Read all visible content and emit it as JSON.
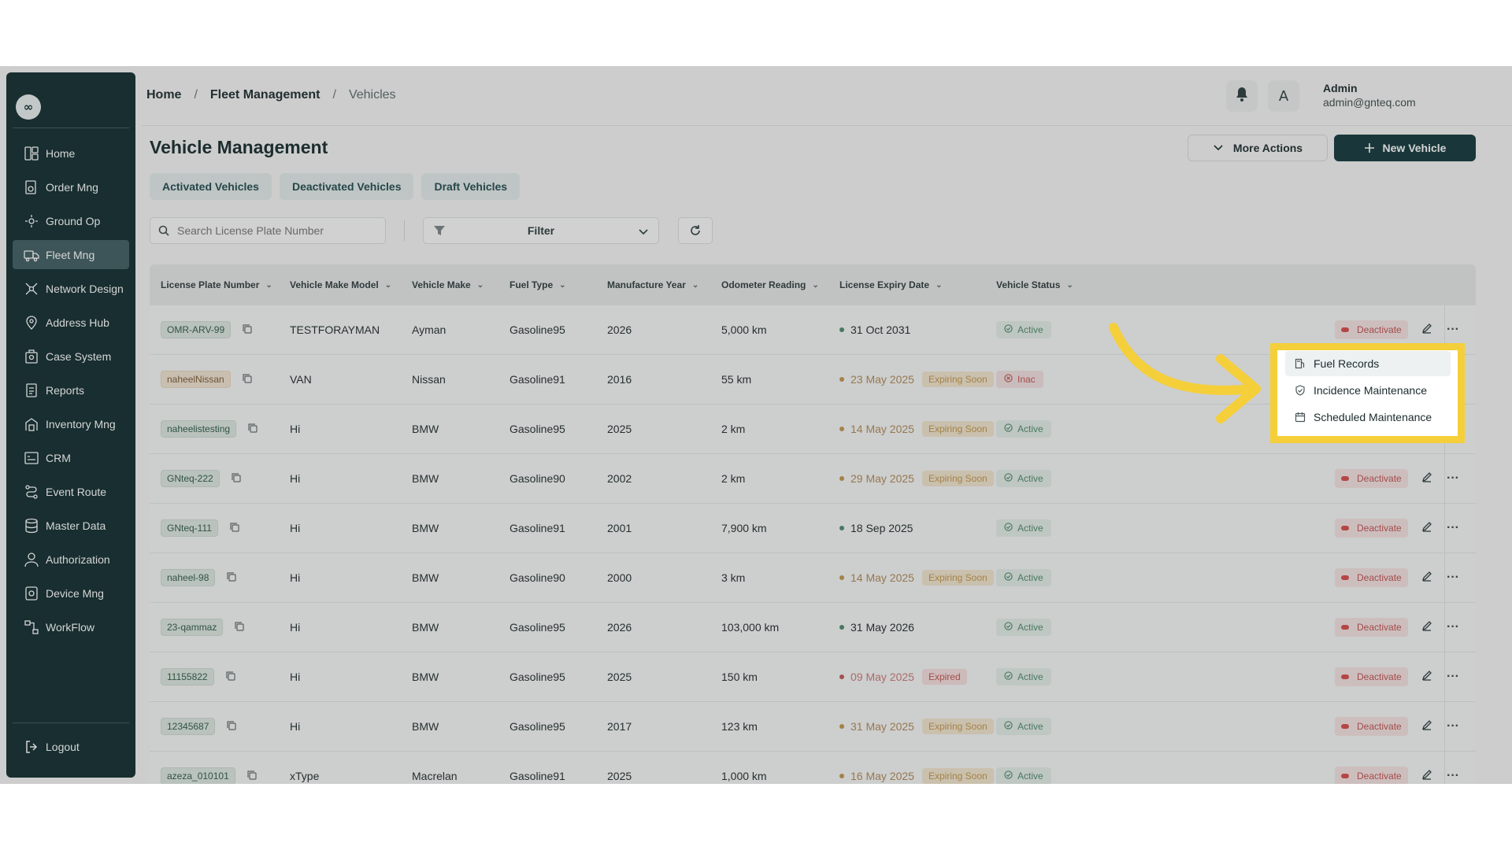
{
  "sidebar": {
    "logo": "∞",
    "items": [
      {
        "label": "Home",
        "icon": "dashboard-icon"
      },
      {
        "label": "Order Mng",
        "icon": "order-icon"
      },
      {
        "label": "Ground Op",
        "icon": "ground-icon"
      },
      {
        "label": "Fleet Mng",
        "icon": "truck-icon"
      },
      {
        "label": "Network Design",
        "icon": "network-icon"
      },
      {
        "label": "Address Hub",
        "icon": "location-icon"
      },
      {
        "label": "Case System",
        "icon": "case-icon"
      },
      {
        "label": "Reports",
        "icon": "report-icon"
      },
      {
        "label": "Inventory Mng",
        "icon": "inventory-icon"
      },
      {
        "label": "CRM",
        "icon": "crm-icon"
      },
      {
        "label": "Event Route",
        "icon": "route-icon"
      },
      {
        "label": "Master Data",
        "icon": "database-icon"
      },
      {
        "label": "Authorization",
        "icon": "user-icon"
      },
      {
        "label": "Device Mng",
        "icon": "device-icon"
      },
      {
        "label": "WorkFlow",
        "icon": "workflow-icon"
      }
    ],
    "active_index": 3,
    "logout_label": "Logout"
  },
  "header": {
    "breadcrumbs": [
      "Home",
      "Fleet Management",
      "Vehicles"
    ],
    "separator": "/",
    "translate_glyph": "A",
    "user_name": "Admin",
    "user_email": "admin@gnteq.com"
  },
  "page": {
    "title": "Vehicle Management",
    "more_actions_label": "More Actions",
    "new_vehicle_label": "New Vehicle",
    "tabs": [
      "Activated Vehicles",
      "Deactivated Vehicles",
      "Draft Vehicles"
    ],
    "search_placeholder": "Search License Plate Number",
    "filter_label": "Filter"
  },
  "table": {
    "columns": [
      "License Plate Number",
      "Vehicle Make Model",
      "Vehicle Make",
      "Fuel Type",
      "Manufacture Year",
      "Odometer Reading",
      "License Expiry Date",
      "Vehicle Status"
    ],
    "rows": [
      {
        "plate": "OMR-ARV-99",
        "plate_tone": "green",
        "model": "TESTFORAYMAN",
        "make": "Ayman",
        "fuel": "Gasoline95",
        "year": "2026",
        "odometer": "5,000 km",
        "expiry": "31 Oct 2031",
        "expiry_tag": "",
        "status": "Active",
        "action": "Deactivate"
      },
      {
        "plate": "naheelNissan",
        "plate_tone": "warn",
        "model": "VAN",
        "make": "Nissan",
        "fuel": "Gasoline91",
        "year": "2016",
        "odometer": "55 km",
        "expiry": "23 May 2025",
        "expiry_tag": "Expiring Soon",
        "status": "Inac",
        "action": ""
      },
      {
        "plate": "naheelistesting",
        "plate_tone": "green",
        "model": "Hi",
        "make": "BMW",
        "fuel": "Gasoline95",
        "year": "2025",
        "odometer": "2 km",
        "expiry": "14 May 2025",
        "expiry_tag": "Expiring Soon",
        "status": "Active",
        "action": ""
      },
      {
        "plate": "GNteq-222",
        "plate_tone": "green",
        "model": "Hi",
        "make": "BMW",
        "fuel": "Gasoline90",
        "year": "2002",
        "odometer": "2 km",
        "expiry": "29 May 2025",
        "expiry_tag": "Expiring Soon",
        "status": "Active",
        "action": "Deactivate"
      },
      {
        "plate": "GNteq-111",
        "plate_tone": "green",
        "model": "Hi",
        "make": "BMW",
        "fuel": "Gasoline91",
        "year": "2001",
        "odometer": "7,900 km",
        "expiry": "18 Sep 2025",
        "expiry_tag": "",
        "status": "Active",
        "action": "Deactivate"
      },
      {
        "plate": "naheel-98",
        "plate_tone": "green",
        "model": "Hi",
        "make": "BMW",
        "fuel": "Gasoline90",
        "year": "2000",
        "odometer": "3 km",
        "expiry": "14 May 2025",
        "expiry_tag": "Expiring Soon",
        "status": "Active",
        "action": "Deactivate"
      },
      {
        "plate": "23-qammaz",
        "plate_tone": "green",
        "model": "Hi",
        "make": "BMW",
        "fuel": "Gasoline95",
        "year": "2026",
        "odometer": "103,000 km",
        "expiry": "31 May 2026",
        "expiry_tag": "",
        "status": "Active",
        "action": "Deactivate"
      },
      {
        "plate": "11155822",
        "plate_tone": "green",
        "model": "Hi",
        "make": "BMW",
        "fuel": "Gasoline95",
        "year": "2025",
        "odometer": "150 km",
        "expiry": "09 May 2025",
        "expiry_tag": "Expired",
        "status": "Active",
        "action": "Deactivate"
      },
      {
        "plate": "12345687",
        "plate_tone": "green",
        "model": "Hi",
        "make": "BMW",
        "fuel": "Gasoline95",
        "year": "2017",
        "odometer": "123 km",
        "expiry": "31 May 2025",
        "expiry_tag": "Expiring Soon",
        "status": "Active",
        "action": "Deactivate"
      },
      {
        "plate": "azeza_010101",
        "plate_tone": "green",
        "model": "xType",
        "make": "Macrelan",
        "fuel": "Gasoline91",
        "year": "2025",
        "odometer": "1,000 km",
        "expiry": "16 May 2025",
        "expiry_tag": "Expiring Soon",
        "status": "Active",
        "action": "Deactivate"
      }
    ]
  },
  "dropdown": {
    "items": [
      {
        "label": "Fuel Records",
        "icon": "fuel-icon"
      },
      {
        "label": "Incidence Maintenance",
        "icon": "shield-icon"
      },
      {
        "label": "Scheduled Maintenance",
        "icon": "calendar-icon"
      }
    ]
  },
  "colors": {
    "sidebar_bg": "#0f2b2e",
    "primary": "#10363a",
    "highlight": "#f5cf3a",
    "danger": "#c0504d",
    "success": "#4d8a6a",
    "warning": "#c29649"
  }
}
